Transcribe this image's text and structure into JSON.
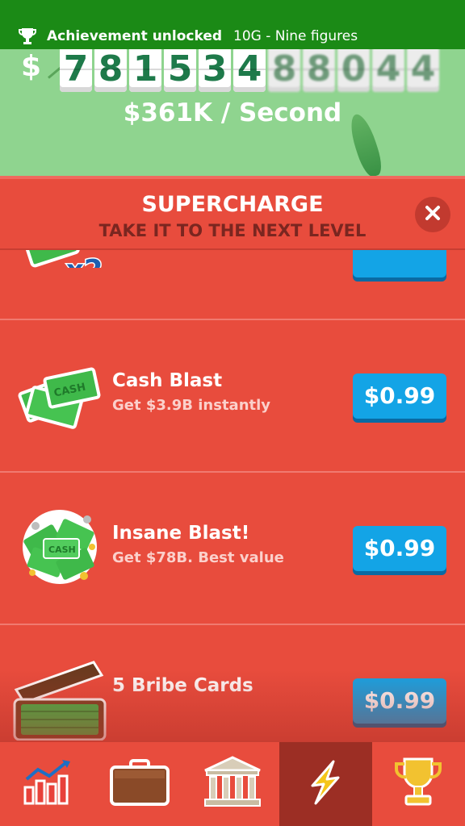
{
  "notification": {
    "title": "Achievement unlocked",
    "detail": "10G - Nine figures",
    "icon": "trophy-icon"
  },
  "balance": {
    "currency_symbol": "$",
    "digits": [
      "7",
      "8",
      "1",
      "5",
      "3",
      "4",
      "8",
      "8",
      "0",
      "4",
      "4"
    ],
    "rate": "$361K / Second"
  },
  "supercharge": {
    "title": "SUPERCHARGE",
    "subtitle": "TAKE IT TO THE NEXT LEVEL",
    "close_icon": "close-icon"
  },
  "items": [
    {
      "name": "",
      "desc": "",
      "price": "",
      "icon": "cash-x2-icon"
    },
    {
      "name": "Cash Blast",
      "desc": "Get $3.9B instantly",
      "price": "$0.99",
      "icon": "cash-stack-icon"
    },
    {
      "name": "Insane Blast!",
      "desc": "Get $78B. Best value",
      "price": "$0.99",
      "icon": "cash-explosion-icon"
    },
    {
      "name": "5 Bribe Cards",
      "desc": "",
      "price": "$0.99",
      "icon": "cash-briefcase-icon"
    }
  ],
  "nav": [
    {
      "icon": "stats-chart-icon",
      "active": false
    },
    {
      "icon": "briefcase-icon",
      "active": false
    },
    {
      "icon": "bank-icon",
      "active": false
    },
    {
      "icon": "lightning-icon",
      "active": true
    },
    {
      "icon": "trophy-icon",
      "active": false
    }
  ],
  "colors": {
    "background": "#e84c3d",
    "money_green": "#8fd48f",
    "toast_green": "#1b8a16",
    "buy_button": "#13a4e6",
    "active_tab": "#9c2e24"
  }
}
